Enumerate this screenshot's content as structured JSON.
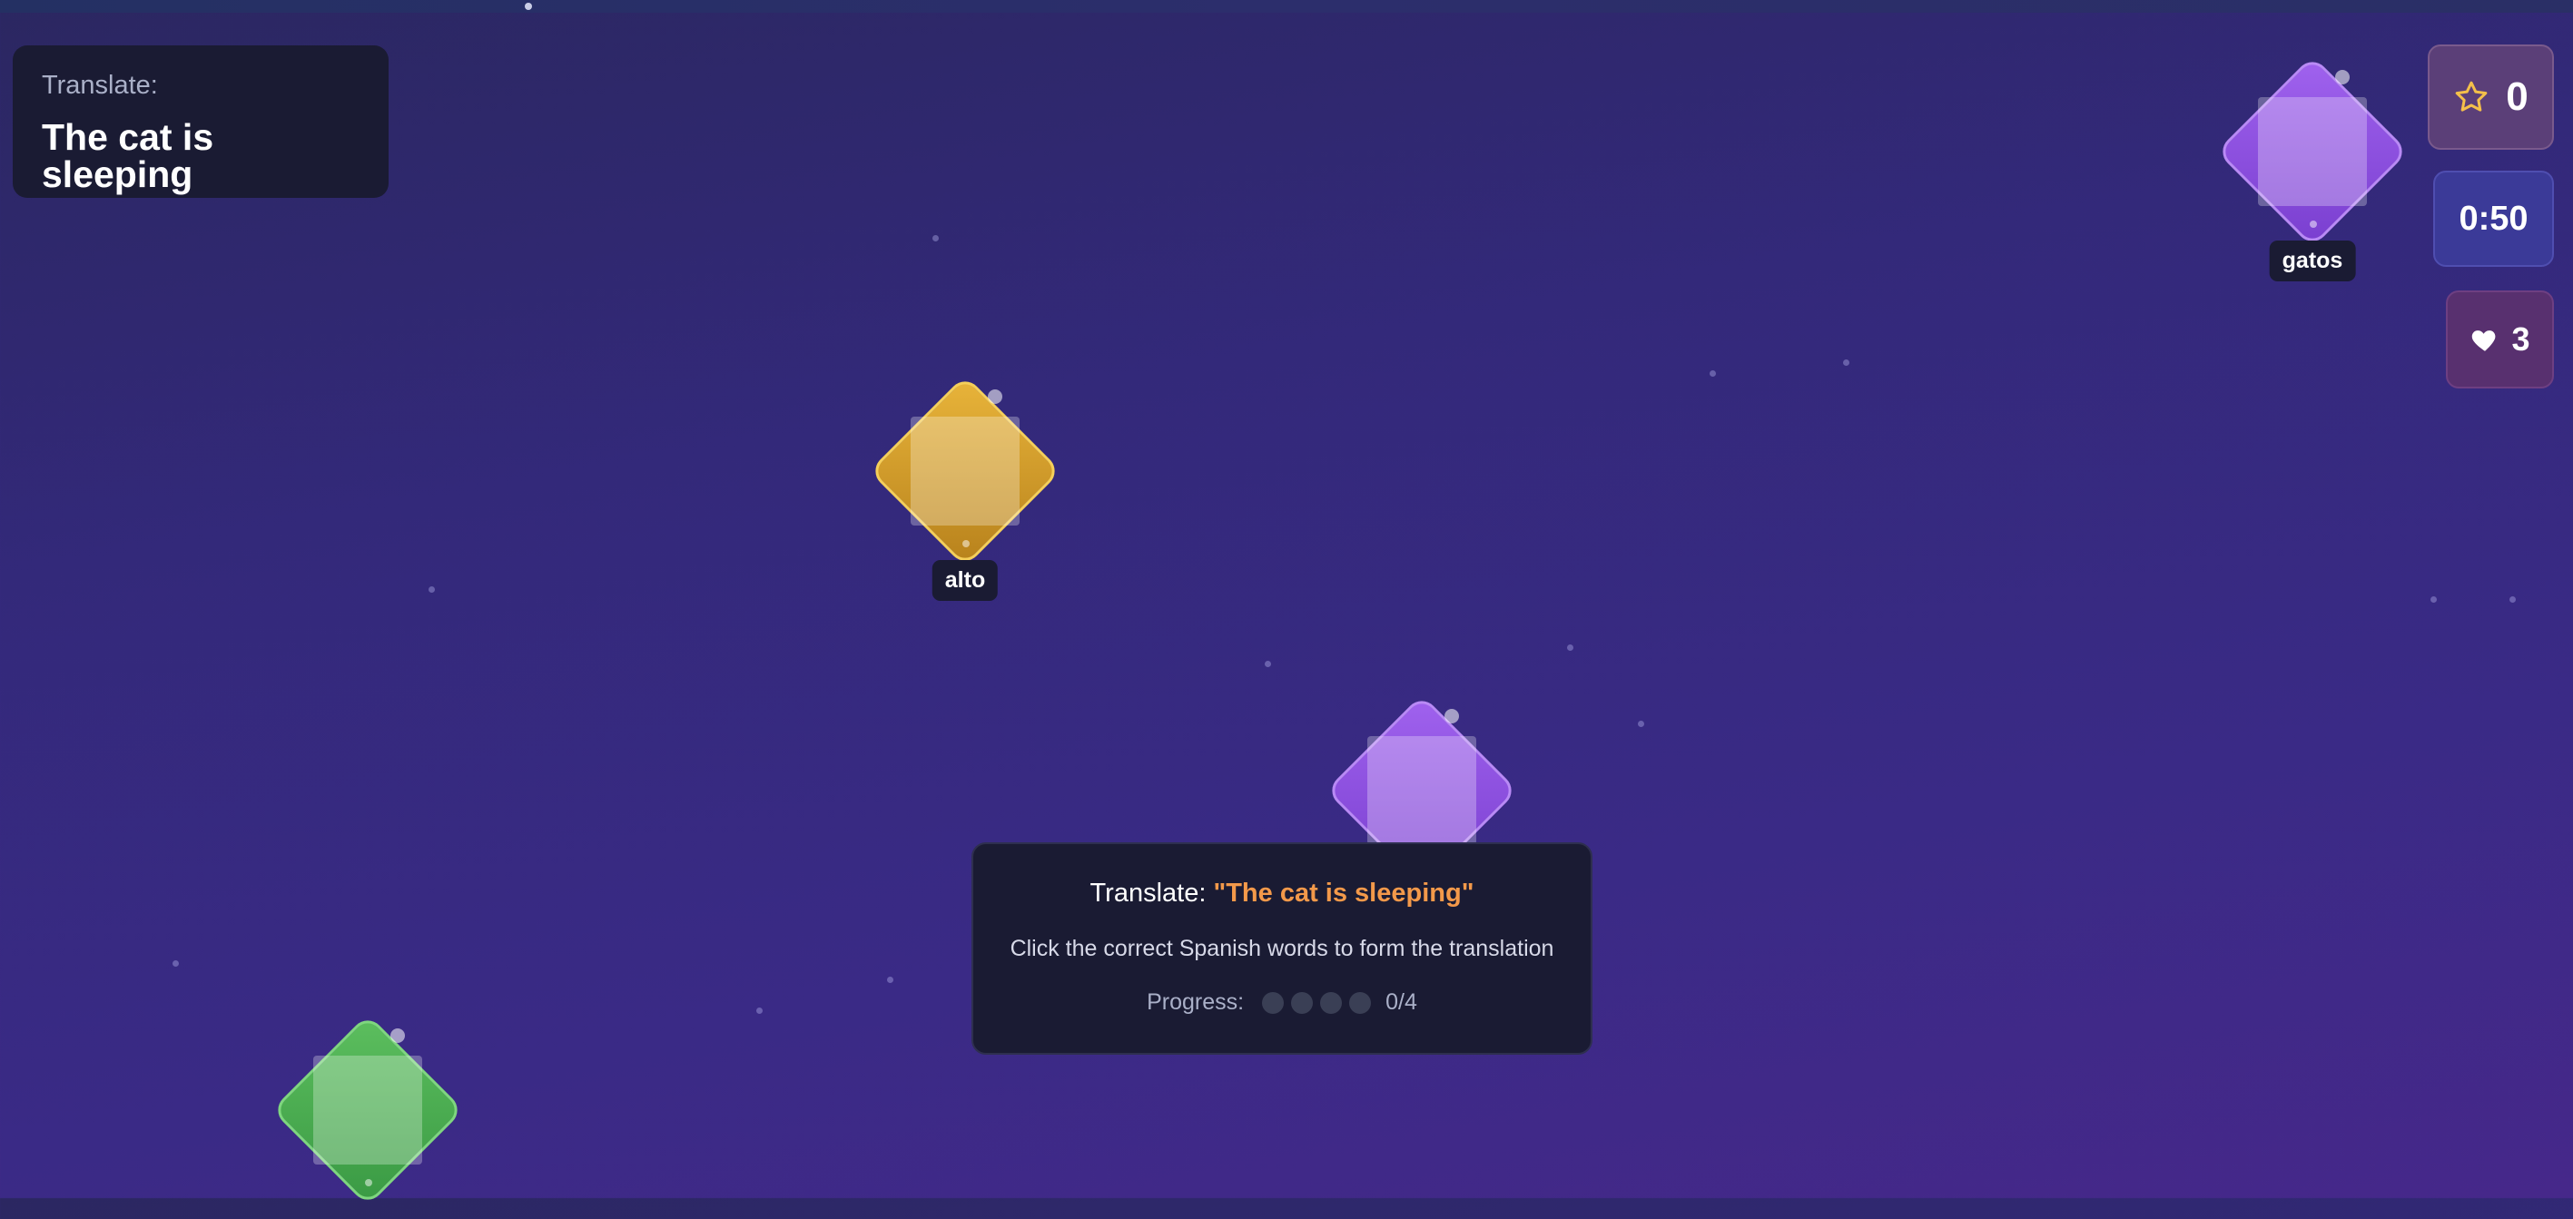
{
  "prompt": {
    "label": "Translate:",
    "phrase": "The cat is sleeping"
  },
  "hud": {
    "score": "0",
    "timer": "0:50",
    "lives": "3"
  },
  "words": [
    {
      "text": "gatos",
      "color": "purple"
    },
    {
      "text": "alto",
      "color": "gold"
    },
    {
      "text": "",
      "color": "purple"
    },
    {
      "text": "",
      "color": "green"
    }
  ],
  "instructions": {
    "title_prefix": "Translate:",
    "title_phrase": "\"The cat is sleeping\"",
    "hint": "Click the correct Spanish words to form the translation",
    "progress_label": "Progress:",
    "progress_count": "0/4",
    "progress_filled": 0,
    "progress_total": 4
  },
  "colors": {
    "gold": "#e8b43a",
    "purple": "#9a5cec",
    "green": "#5cbe5e",
    "highlight": "#f3994a",
    "star": "#f4c04a"
  },
  "icons": {
    "score": "star-icon",
    "lives": "heart-icon"
  }
}
